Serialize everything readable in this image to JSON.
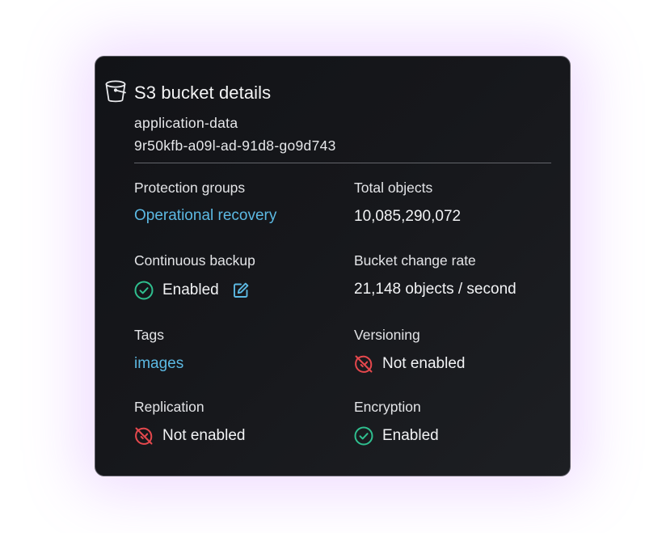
{
  "card": {
    "title": "S3 bucket details",
    "bucket_name": "application-data",
    "bucket_id": "9r50kfb-a09l-ad-91d8-go9d743",
    "icon": "bucket-icon"
  },
  "fields": {
    "protection_groups": {
      "label": "Protection groups",
      "value": "Operational recovery"
    },
    "total_objects": {
      "label": "Total objects",
      "value": "10,085,290,072"
    },
    "continuous_backup": {
      "label": "Continuous backup",
      "value": "Enabled",
      "icon": "check-circle-icon",
      "action_icon": "edit-icon"
    },
    "bucket_change_rate": {
      "label": "Bucket change rate",
      "value": "21,148 objects / second"
    },
    "tags": {
      "label": "Tags",
      "value": "images"
    },
    "versioning": {
      "label": "Versioning",
      "value": "Not enabled",
      "icon": "disabled-circle-icon"
    },
    "replication": {
      "label": "Replication",
      "value": "Not enabled",
      "icon": "disabled-circle-icon"
    },
    "encryption": {
      "label": "Encryption",
      "value": "Enabled",
      "icon": "check-circle-icon"
    }
  },
  "colors": {
    "card_background": "#16171b",
    "link": "#5cb9e3",
    "enabled": "#2fbf8f",
    "not_enabled": "#e5484d",
    "glow": "#c482ff"
  }
}
